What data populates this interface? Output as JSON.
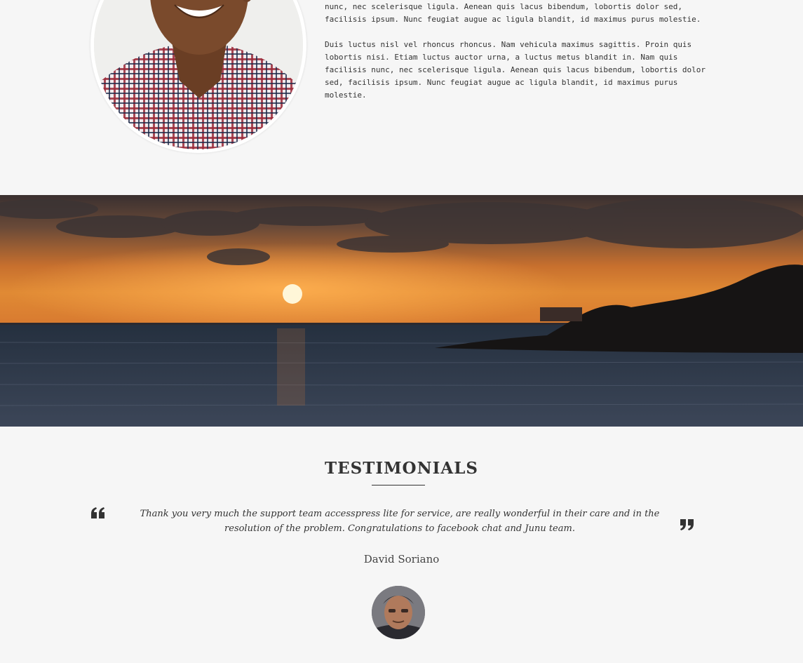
{
  "about": {
    "paragraphs": [
      "nisi. Etiam luctus auctor urna, a luctus metus blandit in. Nam quis facilisis nunc, nec scelerisque ligula. Aenean quis lacus bibendum, lobortis dolor sed, facilisis ipsum. Nunc feugiat augue ac ligula blandit, id maximus purus molestie.",
      "Duis luctus nisl vel rhoncus rhoncus. Nam vehicula maximus sagittis. Proin quis lobortis nisi. Etiam luctus auctor urna, a luctus metus blandit in. Nam quis facilisis nunc, nec scelerisque ligula. Aenean quis lacus bibendum, lobortis dolor sed, facilisis ipsum. Nunc feugiat augue ac ligula blandit, id maximus purus molestie."
    ]
  },
  "testimonials": {
    "title": "TESTIMONIALS",
    "quote": "Thank you very much the support team accesspress lite for service, are really wonderful in their care and in the resolution of the problem. Congratulations to facebook chat and Junu team.",
    "author": "David Soriano",
    "open_quote_icon": "open-quote-icon",
    "close_quote_icon": "close-quote-icon"
  },
  "colors": {
    "background": "#f6f6f6",
    "text": "#333333",
    "sunset_orange": "#e0782a"
  }
}
